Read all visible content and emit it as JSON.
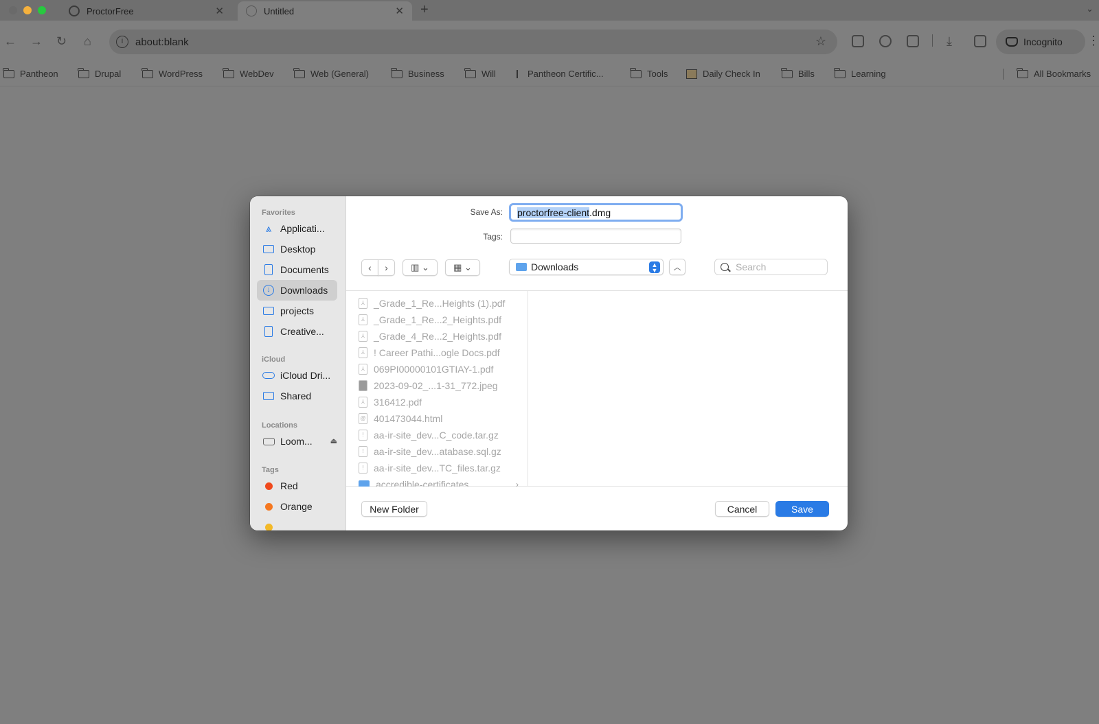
{
  "browser": {
    "tabs": [
      {
        "title": "ProctorFree"
      },
      {
        "title": "Untitled"
      }
    ],
    "url": "about:blank",
    "incognito_label": "Incognito",
    "bookmarks": [
      {
        "label": "Pantheon"
      },
      {
        "label": "Drupal"
      },
      {
        "label": "WordPress"
      },
      {
        "label": "WebDev"
      },
      {
        "label": "Web (General)"
      },
      {
        "label": "Business"
      },
      {
        "label": "Will"
      },
      {
        "label": "Pantheon Certific..."
      },
      {
        "label": "Tools"
      },
      {
        "label": "Daily Check In"
      },
      {
        "label": "Bills"
      },
      {
        "label": "Learning"
      }
    ],
    "all_bookmarks_label": "All Bookmarks"
  },
  "dialog": {
    "sidebar": {
      "favorites_heading": "Favorites",
      "favorites": [
        {
          "label": "Applicati...",
          "icon": "applications-icon"
        },
        {
          "label": "Desktop",
          "icon": "desktop-icon"
        },
        {
          "label": "Documents",
          "icon": "document-icon"
        },
        {
          "label": "Downloads",
          "icon": "downloads-icon"
        },
        {
          "label": "projects",
          "icon": "folder-icon"
        },
        {
          "label": "Creative...",
          "icon": "document-icon"
        }
      ],
      "icloud_heading": "iCloud",
      "icloud": [
        {
          "label": "iCloud Dri...",
          "icon": "cloud-icon"
        },
        {
          "label": "Shared",
          "icon": "shared-folder-icon"
        }
      ],
      "locations_heading": "Locations",
      "locations": [
        {
          "label": "Loom...",
          "icon": "drive-icon"
        }
      ],
      "tags_heading": "Tags",
      "tags": [
        {
          "label": "Red",
          "color": "#f0491c"
        },
        {
          "label": "Orange",
          "color": "#f5771f"
        }
      ]
    },
    "save_as_label": "Save As:",
    "filename_selected": "proctorfree-client",
    "filename_ext": ".dmg",
    "tags_label": "Tags:",
    "location": "Downloads",
    "search_placeholder": "Search",
    "files": [
      {
        "name": "_Grade_1_Re...Heights (1).pdf",
        "kind": "pdf"
      },
      {
        "name": "_Grade_1_Re...2_Heights.pdf",
        "kind": "pdf"
      },
      {
        "name": "_Grade_4_Re...2_Heights.pdf",
        "kind": "pdf"
      },
      {
        "name": "! Career Pathi...ogle Docs.pdf",
        "kind": "pdf"
      },
      {
        "name": "069PI00000101GTIAY-1.pdf",
        "kind": "pdf"
      },
      {
        "name": "2023-09-02_...1-31_772.jpeg",
        "kind": "image"
      },
      {
        "name": "316412.pdf",
        "kind": "pdf"
      },
      {
        "name": "401473044.html",
        "kind": "html"
      },
      {
        "name": "aa-ir-site_dev...C_code.tar.gz",
        "kind": "archive"
      },
      {
        "name": "aa-ir-site_dev...atabase.sql.gz",
        "kind": "archive"
      },
      {
        "name": "aa-ir-site_dev...TC_files.tar.gz",
        "kind": "archive"
      },
      {
        "name": "accredible-certificates",
        "kind": "folder"
      }
    ],
    "new_folder_label": "New Folder",
    "cancel_label": "Cancel",
    "save_label": "Save"
  }
}
